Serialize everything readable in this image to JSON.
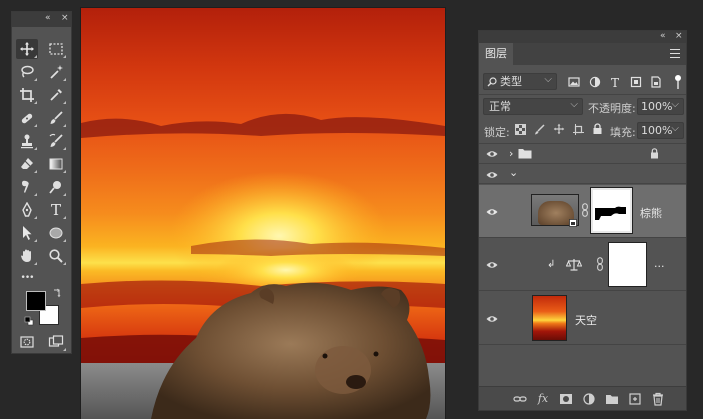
{
  "toolbar": {
    "collapse_glyph": "«",
    "close_glyph": "×",
    "tools": [
      {
        "name": "move-tool",
        "icon": "move-icon",
        "active": true
      },
      {
        "name": "marquee-tool",
        "icon": "marquee-icon"
      },
      {
        "name": "lasso-tool",
        "icon": "lasso-icon"
      },
      {
        "name": "magic-wand-tool",
        "icon": "magic-wand-icon"
      },
      {
        "name": "crop-tool",
        "icon": "crop-icon"
      },
      {
        "name": "eyedropper-tool",
        "icon": "eyedropper-icon"
      },
      {
        "name": "healing-brush-tool",
        "icon": "bandage-icon"
      },
      {
        "name": "brush-tool",
        "icon": "brush-icon"
      },
      {
        "name": "clone-stamp-tool",
        "icon": "stamp-icon"
      },
      {
        "name": "history-brush-tool",
        "icon": "history-brush-icon"
      },
      {
        "name": "eraser-tool",
        "icon": "eraser-icon"
      },
      {
        "name": "gradient-tool",
        "icon": "gradient-icon"
      },
      {
        "name": "blur-tool",
        "icon": "blur-icon"
      },
      {
        "name": "dodge-tool",
        "icon": "dodge-icon"
      },
      {
        "name": "pen-tool",
        "icon": "pen-icon"
      },
      {
        "name": "type-tool",
        "icon": "type-icon"
      },
      {
        "name": "path-selection-tool",
        "icon": "arrow-icon"
      },
      {
        "name": "ellipse-tool",
        "icon": "ellipse-icon"
      },
      {
        "name": "hand-tool",
        "icon": "hand-icon"
      },
      {
        "name": "zoom-tool",
        "icon": "zoom-icon"
      }
    ],
    "more_glyph": "•••",
    "type_glyph": "T",
    "foreground_color": "#000000",
    "background_color": "#ffffff"
  },
  "layers_panel": {
    "collapse_glyph": "«",
    "close_glyph": "×",
    "tab_label": "图层",
    "filter": {
      "icon": "search-icon",
      "value": "类型"
    },
    "filter_icons": [
      "image-filter-icon",
      "adjustment-filter-icon",
      "type-filter-icon",
      "shape-filter-icon",
      "smart-object-filter-icon"
    ],
    "blend_mode": "正常",
    "opacity_label": "不透明度:",
    "opacity_value": "100%",
    "lock_label": "锁定:",
    "fill_label": "填充:",
    "fill_value": "100%",
    "lock_icons": [
      "lock-transparent-icon",
      "lock-paint-icon",
      "lock-move-icon",
      "lock-artboard-icon",
      "lock-all-icon"
    ],
    "group_chevron": "›",
    "subgroup_chevron": "⌄",
    "clip_glyph": "↲",
    "layers": [
      {
        "type": "group",
        "name": "",
        "locked": true
      },
      {
        "type": "group-open",
        "name": ""
      },
      {
        "type": "layer",
        "name": "棕熊",
        "selected": true,
        "has_mask": true
      },
      {
        "type": "adjustment",
        "name": "...",
        "icon": "balance-icon",
        "has_mask": true
      },
      {
        "type": "layer",
        "name": "天空"
      }
    ],
    "footer_icons": [
      "link-icon",
      "fx-icon",
      "mask-icon",
      "adjustment-icon",
      "new-group-icon",
      "new-layer-icon",
      "trash-icon"
    ],
    "fx_label": "fx"
  },
  "colors": {
    "ui_dark": "#282828",
    "panel": "#535353",
    "selected_row": "#6e6e6e"
  }
}
